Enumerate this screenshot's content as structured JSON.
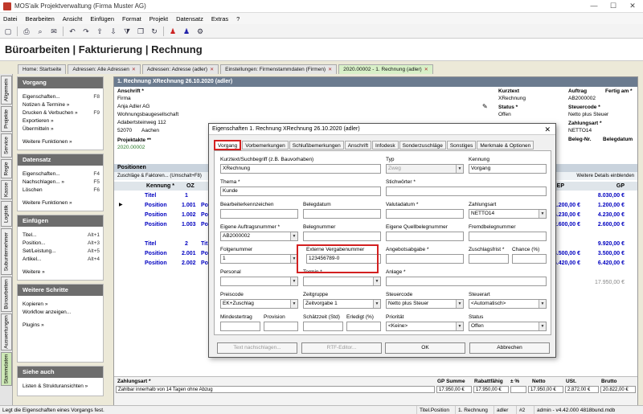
{
  "window": {
    "title": "MOS'aik Projektverwaltung (Firma Muster AG)"
  },
  "menu": [
    "Datei",
    "Bearbeiten",
    "Ansicht",
    "Einfügen",
    "Format",
    "Projekt",
    "Datensatz",
    "Extras",
    "?"
  ],
  "toolbar_icons": [
    "new-icon",
    "print-icon",
    "preview-icon",
    "mail-icon",
    "undo-icon",
    "redo-icon",
    "up-icon",
    "down-icon",
    "filter-icon",
    "copy-icon",
    "refresh-icon",
    "user-icon",
    "user2-icon",
    "settings-icon"
  ],
  "header": {
    "title": "Büroarbeiten | Fakturierung | Rechnung"
  },
  "tabs": [
    {
      "label": "Home: Startseite",
      "closable": false
    },
    {
      "label": "Adressen: Alle Adressen",
      "closable": true
    },
    {
      "label": "Adressen: Adresse (adler)",
      "closable": true
    },
    {
      "label": "Einstellungen: Firmenstammdaten (Firmen)",
      "closable": true
    },
    {
      "label": "2020.00002 - 1. Rechnung (adler)",
      "closable": true
    }
  ],
  "sidetabs": [
    "Allgemein",
    "Projekte",
    "Service",
    "Regie",
    "Kasse",
    "Logistik",
    "Subunternehmer",
    "Büroarbeiten",
    "Auswertungen",
    "Stammdaten"
  ],
  "left": {
    "vorgang": {
      "title": "Vorgang",
      "items": [
        {
          "label": "Eigenschaften...",
          "shortcut": "F8"
        },
        {
          "label": "Notizen & Termine »",
          "shortcut": ""
        },
        {
          "label": "Drucken & Verbuchen »",
          "shortcut": "F9"
        },
        {
          "label": "Exportieren »",
          "shortcut": ""
        },
        {
          "label": "Übermitteln »",
          "shortcut": ""
        }
      ],
      "more": "Weitere Funktionen »"
    },
    "datensatz": {
      "title": "Datensatz",
      "items": [
        {
          "label": "Eigenschaften...",
          "shortcut": "F4"
        },
        {
          "label": "Nachschlagen... »",
          "shortcut": "F5"
        },
        {
          "label": "Löschen",
          "shortcut": "F6"
        }
      ],
      "more": "Weitere Funktionen »"
    },
    "einfuegen": {
      "title": "Einfügen",
      "items": [
        {
          "label": "Titel...",
          "shortcut": "Alt+1"
        },
        {
          "label": "Position...",
          "shortcut": "Alt+3"
        },
        {
          "label": "Set/Leistung...",
          "shortcut": "Alt+5"
        },
        {
          "label": "Artikel...",
          "shortcut": "Alt+4"
        }
      ],
      "more": "Weitere »"
    },
    "schritte": {
      "title": "Weitere Schritte",
      "items": [
        {
          "label": "Kopieren »",
          "shortcut": ""
        },
        {
          "label": "Workflow anzeigen...",
          "shortcut": ""
        }
      ],
      "more": "Plugins »"
    },
    "siehe": {
      "title": "Siehe auch",
      "items": [
        {
          "label": "Listen & Strukturansichten »",
          "shortcut": ""
        }
      ]
    }
  },
  "main": {
    "heading": "1. Rechnung XRechnung 26.10.2020 (adler)",
    "anschrift_label": "Anschrift *",
    "address": [
      "Firma",
      "Anja Adler AG",
      "Wohnungsbaugesellschaft",
      "Adabertsteinweg 112"
    ],
    "plz": "52070",
    "ort": "Aachen",
    "projektakte_label": "Projektakte **",
    "projektakte": "2020.00002",
    "kurztext_label": "Kurztext",
    "kurztext": "XRechnung",
    "auftrag_label": "Auftrag",
    "auftrag": "AB2000002",
    "fertig_label": "Fertig am *",
    "status_label": "Status *",
    "status": "Offen",
    "steuercode_label": "Steuercode *",
    "steuercode": "Netto plus Steuer",
    "zahlungsart_label": "Zahlungsart *",
    "zahlungsart": "NETTO14",
    "beleg_nr_label": "Beleg-Nr.",
    "belegdatum_label": "Belegdatum",
    "positionen_label": "Positionen",
    "positionen_sub": "Zuschläge & Faktoren... (Umschalt+F8)",
    "details_link": "Weitere Details einblenden",
    "col_kennung": "Kennung *",
    "col_oz": "OZ",
    "col_ep": "EP",
    "col_gp": "GP",
    "rows": [
      {
        "kennung": "Titel",
        "oz": "1",
        "nr": "",
        "ep": "",
        "gp": "8.030,00 €"
      },
      {
        "kennung": "Position",
        "oz": "1.001",
        "nr": "Po",
        "ep": "1.200,00 €",
        "gp": "1.200,00 €"
      },
      {
        "kennung": "Position",
        "oz": "1.002",
        "nr": "Po",
        "ep": "4.230,00 €",
        "gp": "4.230,00 €"
      },
      {
        "kennung": "Position",
        "oz": "1.003",
        "nr": "Po",
        "ep": "2.600,00 €",
        "gp": "2.600,00 €"
      },
      {
        "kennung": "",
        "oz": "",
        "nr": "",
        "ep": "",
        "gp": ""
      },
      {
        "kennung": "Titel",
        "oz": "2",
        "nr": "Tit",
        "ep": "",
        "gp": "9.920,00 €"
      },
      {
        "kennung": "Position",
        "oz": "2.001",
        "nr": "Po",
        "ep": "3.500,00 €",
        "gp": "3.500,00 €"
      },
      {
        "kennung": "Position",
        "oz": "2.002",
        "nr": "Po",
        "ep": "6.420,00 €",
        "gp": "6.420,00 €"
      }
    ],
    "sum_total": "17.950,00 €",
    "bottom": {
      "zahlungsart_label": "Zahlungsart *",
      "zahlungsart_text": "Zahlbar innerhalb von 14 Tagen ohne Abzug",
      "gp_summe_label": "GP Summe",
      "gp_summe": "17.950,00 €",
      "rabattfahig_label": "Rabattfähig",
      "rabattfahig": "17.950,00 €",
      "prozent_label": "± %",
      "netto_label": "Netto",
      "netto": "17.950,00 €",
      "ust_label": "USt.",
      "ust": "2.872,00 €",
      "brutto_label": "Brutto",
      "brutto": "20.822,00 €"
    }
  },
  "dialog": {
    "title": "Eigenschaften 1. Rechnung XRechnung 26.10.2020 (adler)",
    "tabs": [
      "Vorgang",
      "Vorbemerkungen",
      "Schlußbemerkungen",
      "Anschrift",
      "Infodesk",
      "Sonderzuschläge",
      "Sonstiges",
      "Merkmale & Optionen"
    ],
    "fields": {
      "kurztext_label": "Kurztext/Suchbegriff (z.B. Bauvorhaben)",
      "kurztext": "XRechnung",
      "typ_label": "Typ",
      "typ": "Zweg",
      "kennung_label": "Kennung",
      "kennung": "Vorgang",
      "thema_label": "Thema *",
      "thema": "Kunde",
      "stichwoerter_label": "Stichwörter *",
      "bearbeiter_label": "Bearbeiterkennzeichen",
      "belegdatum_label": "Belegdatum",
      "valutadatum_label": "Valutadatum *",
      "zahlungsart_label": "Zahlungsart",
      "zahlungsart": "NETTO14",
      "auftragsnummer_label": "Eigene Auftragsnummer *",
      "auftragsnummer": "AB2000002",
      "belegnummer_label": "Belegnummer",
      "quellbeleg_label": "Eigene Quellbelegnummer",
      "fremdbeleg_label": "Fremdbelegnummer",
      "folgenummer_label": "Folgenummer",
      "folgenummer": "1",
      "vergabenummer_label": "Externe Vergabenummer",
      "vergabenummer": "123456789-0",
      "angebotsabgabe_label": "Angebotsabgabe *",
      "zuschlagsfrist_label": "Zuschlagsfrist *",
      "chance_label": "Chance (%)",
      "personal_label": "Personal",
      "termin_label": "Termin *",
      "anlage_label": "Anlage *",
      "preiscode_label": "Preiscode",
      "preiscode": "EK+Zuschlag",
      "zeitgruppe_label": "Zeitgruppe",
      "zeitgruppe": "Zeitvorgabe 1",
      "steuercode_label": "Steuercode",
      "steuercode": "Netto plus Steuer",
      "steuerart_label": "Steuerart",
      "steuerart": "<Automatisch>",
      "mindestertrag_label": "Mindestertrag",
      "provision_label": "Provision",
      "schaetzzeit_label": "Schätzzeit (Std)",
      "erledigt_label": "Erledigt (%)",
      "prioritaet_label": "Priorität",
      "prioritaet": "<Keine>",
      "status_label": "Status",
      "status": "Offen"
    },
    "buttons": {
      "text_label": "Text nachschlagen...",
      "rtf_label": "RTF-Editor...",
      "ok_label": "OK",
      "cancel_label": "Abbrechen"
    }
  },
  "statusbar": {
    "message": "Legt die Eigenschaften eines Vorgangs fest.",
    "field": "Titel.Position",
    "doc": "1. Rechnung",
    "user": "adler",
    "num": "#2",
    "admin": "admin - v4.42.000 4818bund.mdb"
  }
}
